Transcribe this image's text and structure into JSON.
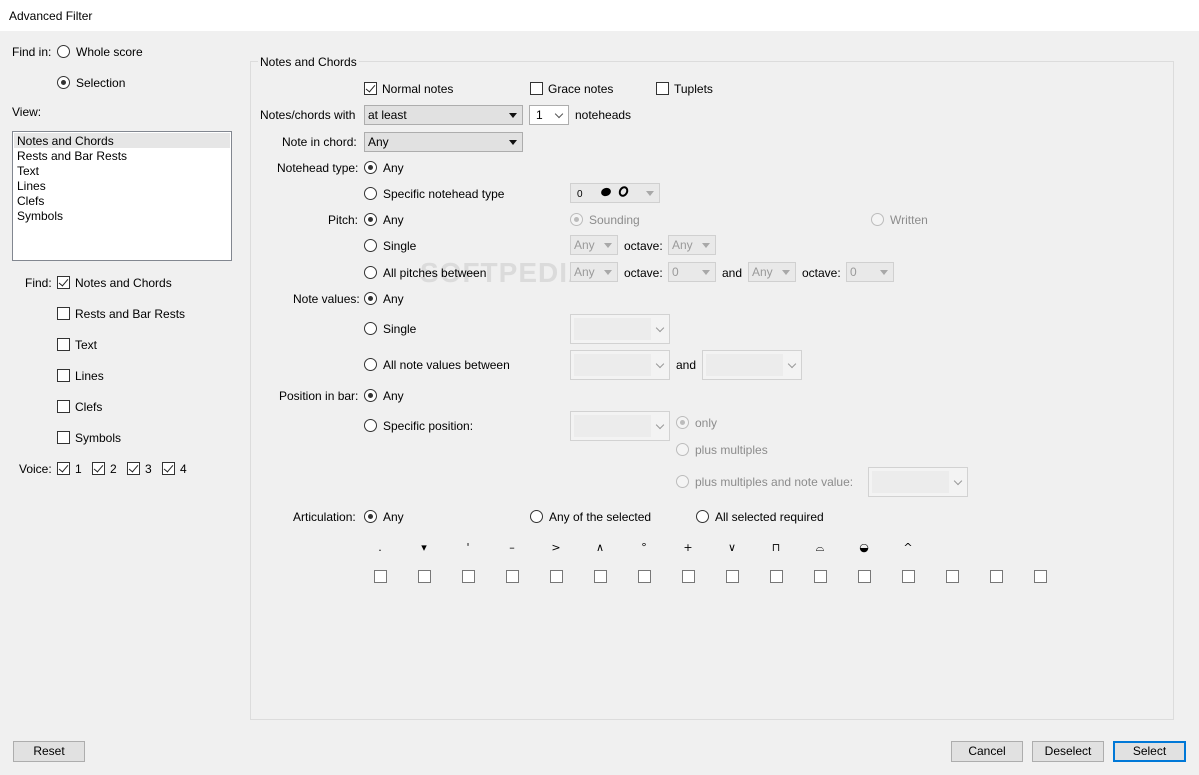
{
  "window": {
    "title": "Advanced Filter"
  },
  "find_in": {
    "label": "Find in:",
    "options": [
      {
        "label": "Whole score",
        "selected": false
      },
      {
        "label": "Selection",
        "selected": true
      }
    ]
  },
  "view": {
    "label": "View:",
    "items": [
      "Notes and Chords",
      "Rests and Bar Rests",
      "Text",
      "Lines",
      "Clefs",
      "Symbols"
    ],
    "selected_index": 0
  },
  "find": {
    "label": "Find:",
    "items": [
      {
        "label": "Notes and Chords",
        "checked": true
      },
      {
        "label": "Rests and Bar Rests",
        "checked": false
      },
      {
        "label": "Text",
        "checked": false
      },
      {
        "label": "Lines",
        "checked": false
      },
      {
        "label": "Clefs",
        "checked": false
      },
      {
        "label": "Symbols",
        "checked": false
      }
    ]
  },
  "voice": {
    "label": "Voice:",
    "items": [
      {
        "label": "1",
        "checked": true
      },
      {
        "label": "2",
        "checked": true
      },
      {
        "label": "3",
        "checked": true
      },
      {
        "label": "4",
        "checked": true
      }
    ]
  },
  "panel": {
    "title": "Notes and Chords",
    "types": [
      {
        "label": "Normal notes",
        "checked": true
      },
      {
        "label": "Grace notes",
        "checked": false
      },
      {
        "label": "Tuplets",
        "checked": false
      }
    ],
    "with": {
      "label": "Notes/chords with",
      "qualifier": "at least",
      "count": "1",
      "suffix": "noteheads"
    },
    "note_in_chord": {
      "label": "Note in chord:",
      "value": "Any"
    },
    "notehead": {
      "label": "Notehead type:",
      "any": "Any",
      "specific": "Specific notehead type",
      "combo_value": "0"
    },
    "pitch": {
      "label": "Pitch:",
      "any": "Any",
      "sounding": "Sounding",
      "written": "Written",
      "single": "Single",
      "single_value": "Any",
      "octave_label": "octave:",
      "single_octave": "Any",
      "between": "All pitches between",
      "between_from": "Any",
      "between_from_octave": "0",
      "and_label": "and",
      "between_to": "Any",
      "between_to_octave": "0"
    },
    "note_values": {
      "label": "Note values:",
      "any": "Any",
      "single": "Single",
      "between": "All note values between",
      "and_label": "and"
    },
    "position": {
      "label": "Position in bar:",
      "any": "Any",
      "specific": "Specific position:",
      "only": "only",
      "plus_multiples": "plus multiples",
      "plus_multiples_note": "plus multiples and note value:"
    },
    "articulation": {
      "label": "Articulation:",
      "any": "Any",
      "any_selected": "Any of the selected",
      "all_required": "All selected required",
      "symbols": [
        ".",
        "▾",
        "'",
        "–",
        ">",
        "∧",
        "°",
        "+",
        "∨",
        "⊓",
        "⌓",
        "◒",
        "^",
        "",
        "",
        ""
      ]
    }
  },
  "buttons": {
    "reset": "Reset",
    "cancel": "Cancel",
    "deselect": "Deselect",
    "select": "Select"
  },
  "watermark": "SOFTPEDIA"
}
